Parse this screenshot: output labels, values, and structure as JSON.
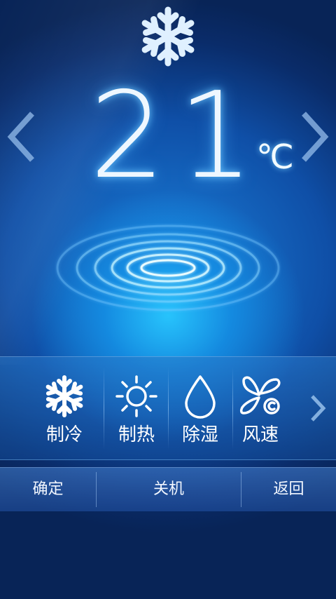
{
  "current_mode_icon": "snowflake-icon",
  "temperature": {
    "value": "21",
    "unit": "℃"
  },
  "modes": [
    {
      "icon": "snowflake-icon",
      "label": "制冷"
    },
    {
      "icon": "sun-icon",
      "label": "制热"
    },
    {
      "icon": "water-drop-icon",
      "label": "除湿"
    },
    {
      "icon": "fan-icon",
      "label": "风速"
    }
  ],
  "bottom_bar": {
    "confirm": "确定",
    "power_off": "关机",
    "back": "返回"
  },
  "colors": {
    "background_dark": "#0b2a63",
    "background_glow": "#28c8ff",
    "text": "#ffffff"
  }
}
